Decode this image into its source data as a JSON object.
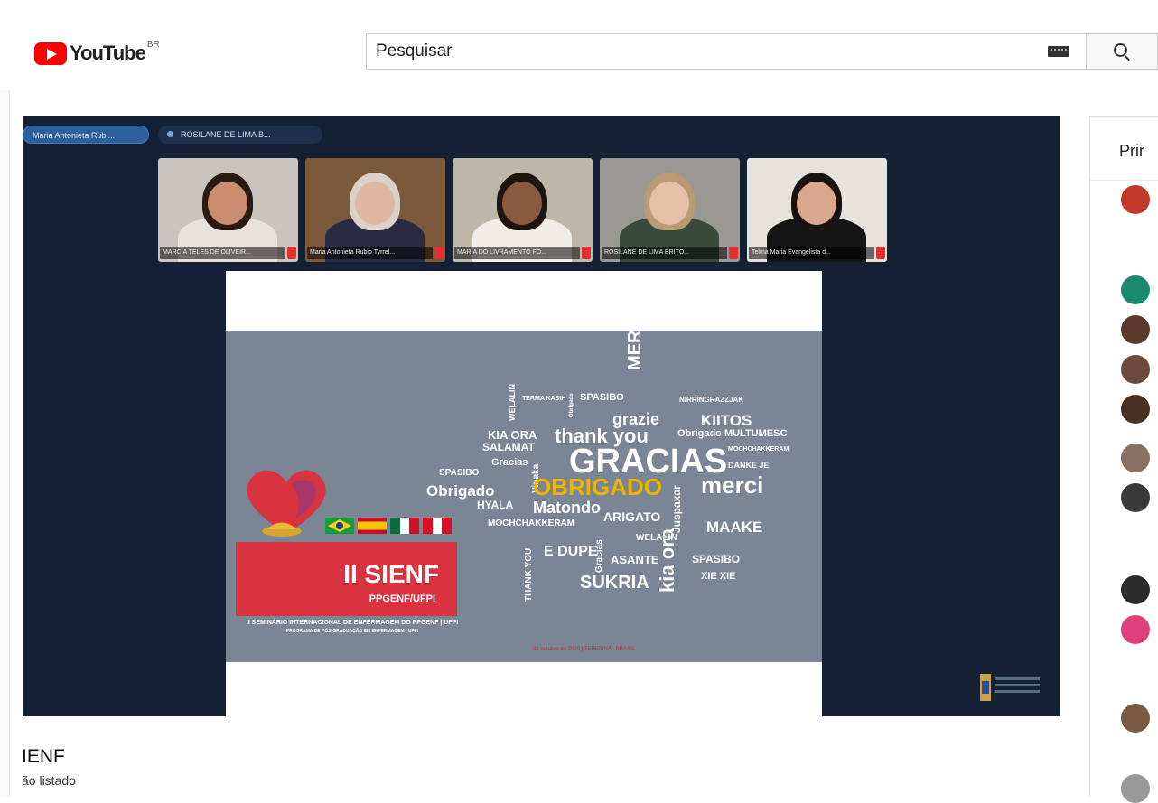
{
  "header": {
    "logo_text": "YouTube",
    "country_code": "BR",
    "search_placeholder": "Pesquisar"
  },
  "meeting": {
    "chips": [
      "Maria Antonieta Rubi...",
      "ROSILANE DE LIMA B..."
    ],
    "participants": [
      {
        "name": "MARCIA TELES DE OLIVEIR...",
        "bg": "#c9c4bd",
        "skin": "#c98e70",
        "hair": "#2a1a12",
        "shirt": "#e8e2dc"
      },
      {
        "name": "Maria Antonieta Rubio Tyrrel...",
        "bg": "#7a5a3a",
        "skin": "#e0b7a0",
        "hair": "#d8d2ca",
        "shirt": "#2a2a44"
      },
      {
        "name": "MARIA DO LIVRAMENTO FO...",
        "bg": "#bfb6aa",
        "skin": "#8a5a3e",
        "hair": "#1e1410",
        "shirt": "#f0ece6"
      },
      {
        "name": "ROSILANE DE LIMA BRITO...",
        "bg": "#9a9893",
        "skin": "#e7c0a8",
        "hair": "#b99a72",
        "shirt": "#3a4a3a"
      },
      {
        "name": "Telma Maria Evangelista d...",
        "bg": "#e6e2dc",
        "skin": "#d9a78d",
        "hair": "#1a1210",
        "shirt": "#151515"
      }
    ]
  },
  "slide": {
    "title": "II SIENF",
    "subtitle": "PPGENF/UFPI",
    "description": "II SEMINÁRIO INTERNACIONAL DE ENFERMAGEM DO PPGENF | UFPI",
    "description_small": "PROGRAMA DE PÓS-GRADUAÇÃO EM ENFERMAGEM | UFPI",
    "footer": "02 outubro de 2020 | TERESINA - BRASIL",
    "words": [
      "MERCI",
      "TERMA KASIH",
      "SPASIBO",
      "NIRRINGRAZZJAK",
      "WELALIN",
      "Obrigado",
      "grazie",
      "KIITOS",
      "KIA ORA",
      "thank you",
      "Obrigado MULTUMESC",
      "SALAMAT",
      "MOCHCHAKKERAM",
      "Gracias",
      "GRACIAS",
      "DANKE JE",
      "SPASIBO",
      "Vinaka",
      "OBRIGADO",
      "merci",
      "Obrigado",
      "HYALA",
      "Matondo",
      "ARIGATO",
      "Juspaxar",
      "MOCHCHAKKERAM",
      "Gracias",
      "MAAKE",
      "THANK YOU",
      "E DUPE",
      "WELALIN",
      "ASANTE",
      "SPASIBO",
      "kia ora",
      "SUKRIA",
      "XIE XIE"
    ]
  },
  "video": {
    "title": "IENF",
    "privacy": "ão listado"
  },
  "chat": {
    "header": "Prir",
    "avatar_colors": [
      "#c0392b",
      "#1a8a6e",
      "#5a3a2a",
      "#6a4a3a",
      "#4a3020",
      "#8a7060",
      "#3a3a3a",
      "#2a2a2a",
      "#e0407a",
      "#7a5a40",
      "#999999"
    ]
  },
  "colors": {
    "brand_red": "#ff0000",
    "player_bg": "#142033",
    "slide_bg": "#7a8596",
    "accent_yellow": "#f0b400",
    "sienf_red": "#d9333f"
  }
}
